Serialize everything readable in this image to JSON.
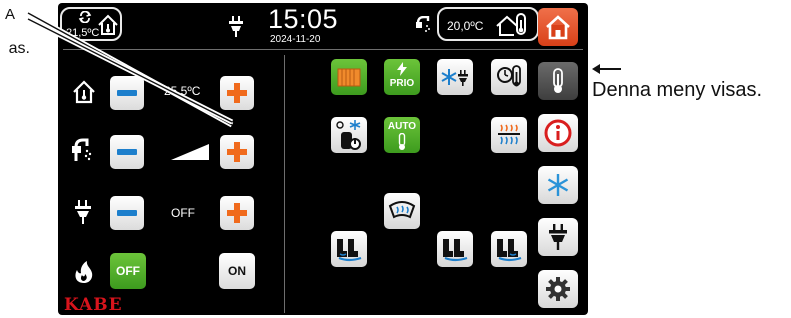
{
  "annotations": {
    "label_a": "A",
    "label_as": "as.",
    "label_menu": "Denna meny visas."
  },
  "status_bar": {
    "inside_temp": "21,5ºC",
    "time": "15:05",
    "date": "2024-11-20",
    "outside_temp": "20,0ºC"
  },
  "heating_rows": {
    "row1_value": "25,5ºC",
    "row3_value": "OFF",
    "row4_off_label": "OFF",
    "row4_on_label": "ON"
  },
  "quick_tiles": {
    "prio_label": "PRIO",
    "auto_label": "AUTO"
  },
  "brand": "KABE",
  "colors": {
    "accent_blue": "#1d7fcc",
    "accent_orange": "#f06a1c",
    "active_green": "#4caf2a",
    "brand_red": "#d8141c"
  },
  "side_menu": [
    "home-icon",
    "thermometer-icon",
    "info-icon",
    "snowflake-icon",
    "plug-icon",
    "settings-gear-icon"
  ]
}
